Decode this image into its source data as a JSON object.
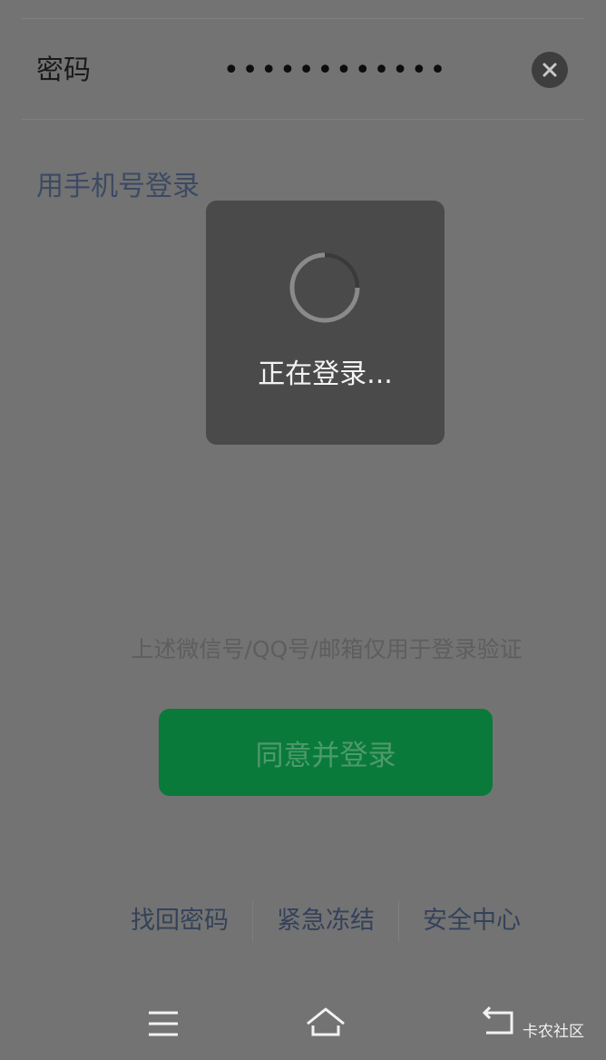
{
  "password_row": {
    "label": "密码",
    "masked_value": "••••••••••••"
  },
  "phone_login_link": "用手机号登录",
  "loading_dialog": {
    "text": "正在登录..."
  },
  "notice_text": "上述微信号/QQ号/邮箱仅用于登录验证",
  "login_button": "同意并登录",
  "bottom_links": {
    "recover_password": "找回密码",
    "emergency_freeze": "紧急冻结",
    "security_center": "安全中心"
  },
  "watermark": "卡农社区",
  "colors": {
    "background_overlay": "#737373",
    "button_green": "#0a7a3a",
    "link_blue": "#34425a",
    "dialog_bg": "#4a4a4a"
  },
  "icons": [
    "clear-icon",
    "loading-spinner-icon",
    "menu-icon",
    "home-icon",
    "back-icon"
  ]
}
